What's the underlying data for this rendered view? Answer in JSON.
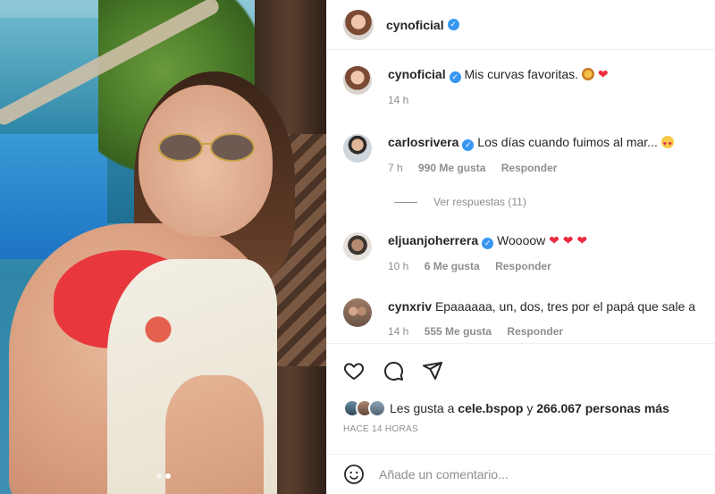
{
  "post": {
    "author": "cynoficial",
    "verified": true
  },
  "caption": {
    "username": "cynoficial",
    "text": "Mis curvas favoritas.",
    "time": "14 h"
  },
  "comments": [
    {
      "username": "carlosrivera",
      "verified": true,
      "text": "Los días cuando fuimos al mar...",
      "time": "7 h",
      "likes": "990 Me gusta",
      "reply": "Responder",
      "view_replies": "Ver respuestas (11)"
    },
    {
      "username": "eljuanjoherrera",
      "verified": true,
      "text": "Woooow",
      "time": "10 h",
      "likes": "6 Me gusta",
      "reply": "Responder"
    },
    {
      "username": "cynxriv",
      "verified": false,
      "text": "Epaaaaaa, un, dos, tres por el papá que sale a",
      "time": "14 h",
      "likes": "555 Me gusta",
      "reply": "Responder"
    }
  ],
  "likes": {
    "prefix": "Les gusta a",
    "first_user": "cele.bspop",
    "joiner": "y",
    "rest": "266.067 personas más"
  },
  "date": "HACE 14 HORAS",
  "add_comment": {
    "placeholder": "Añade un comentario..."
  },
  "icons": {
    "verified": "verified-badge-icon",
    "like": "heart-outline-icon",
    "comment": "speech-bubble-icon",
    "share": "paper-plane-icon",
    "emoji": "smiley-icon"
  },
  "colors": {
    "verified": "#3897f0",
    "muted": "#8e8e8e",
    "text": "#262626",
    "heart": "#ed2b3d"
  },
  "carousel": {
    "slides": 2,
    "active": 2
  }
}
